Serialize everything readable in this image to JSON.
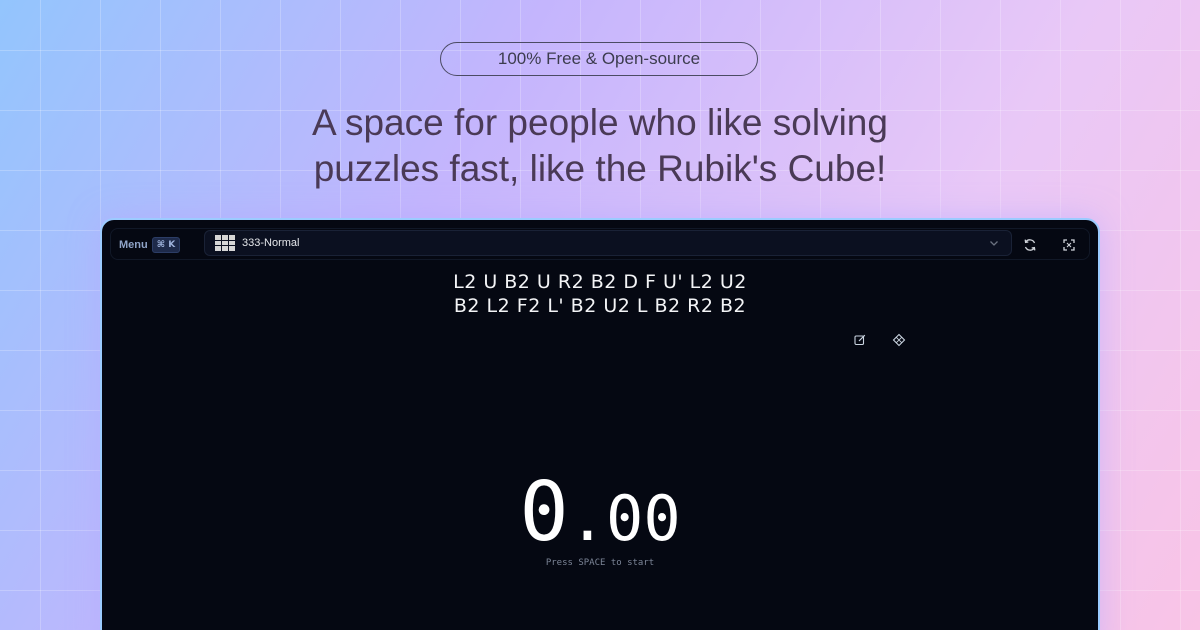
{
  "hero": {
    "badge": "100% Free & Open-source",
    "headline_line1": "A space for people who like solving",
    "headline_line2": "puzzles fast, like the Rubik's Cube!"
  },
  "app": {
    "menu_label": "Menu",
    "menu_shortcut": "⌘ K",
    "puzzle_select": {
      "selected": "333-Normal"
    },
    "icons": {
      "puzzle": "cube-grid-icon",
      "dropdown": "chevron-down-icon",
      "refresh": "refresh-icon",
      "fullscreen": "expand-icon",
      "edit": "edit-icon",
      "settings": "cube-settings-icon"
    },
    "scramble_line1": "L2 U B2 U R2 B2 D F U' L2 U2",
    "scramble_line2": "B2 L2 F2 L' B2 U2 L B2 R2 B2",
    "timer": {
      "int": "0",
      "dec": ".00"
    },
    "hint": "Press SPACE to start"
  },
  "colors": {
    "app_background": "#050812",
    "app_border": "#9ccbff",
    "headline": "#4a3a56"
  }
}
